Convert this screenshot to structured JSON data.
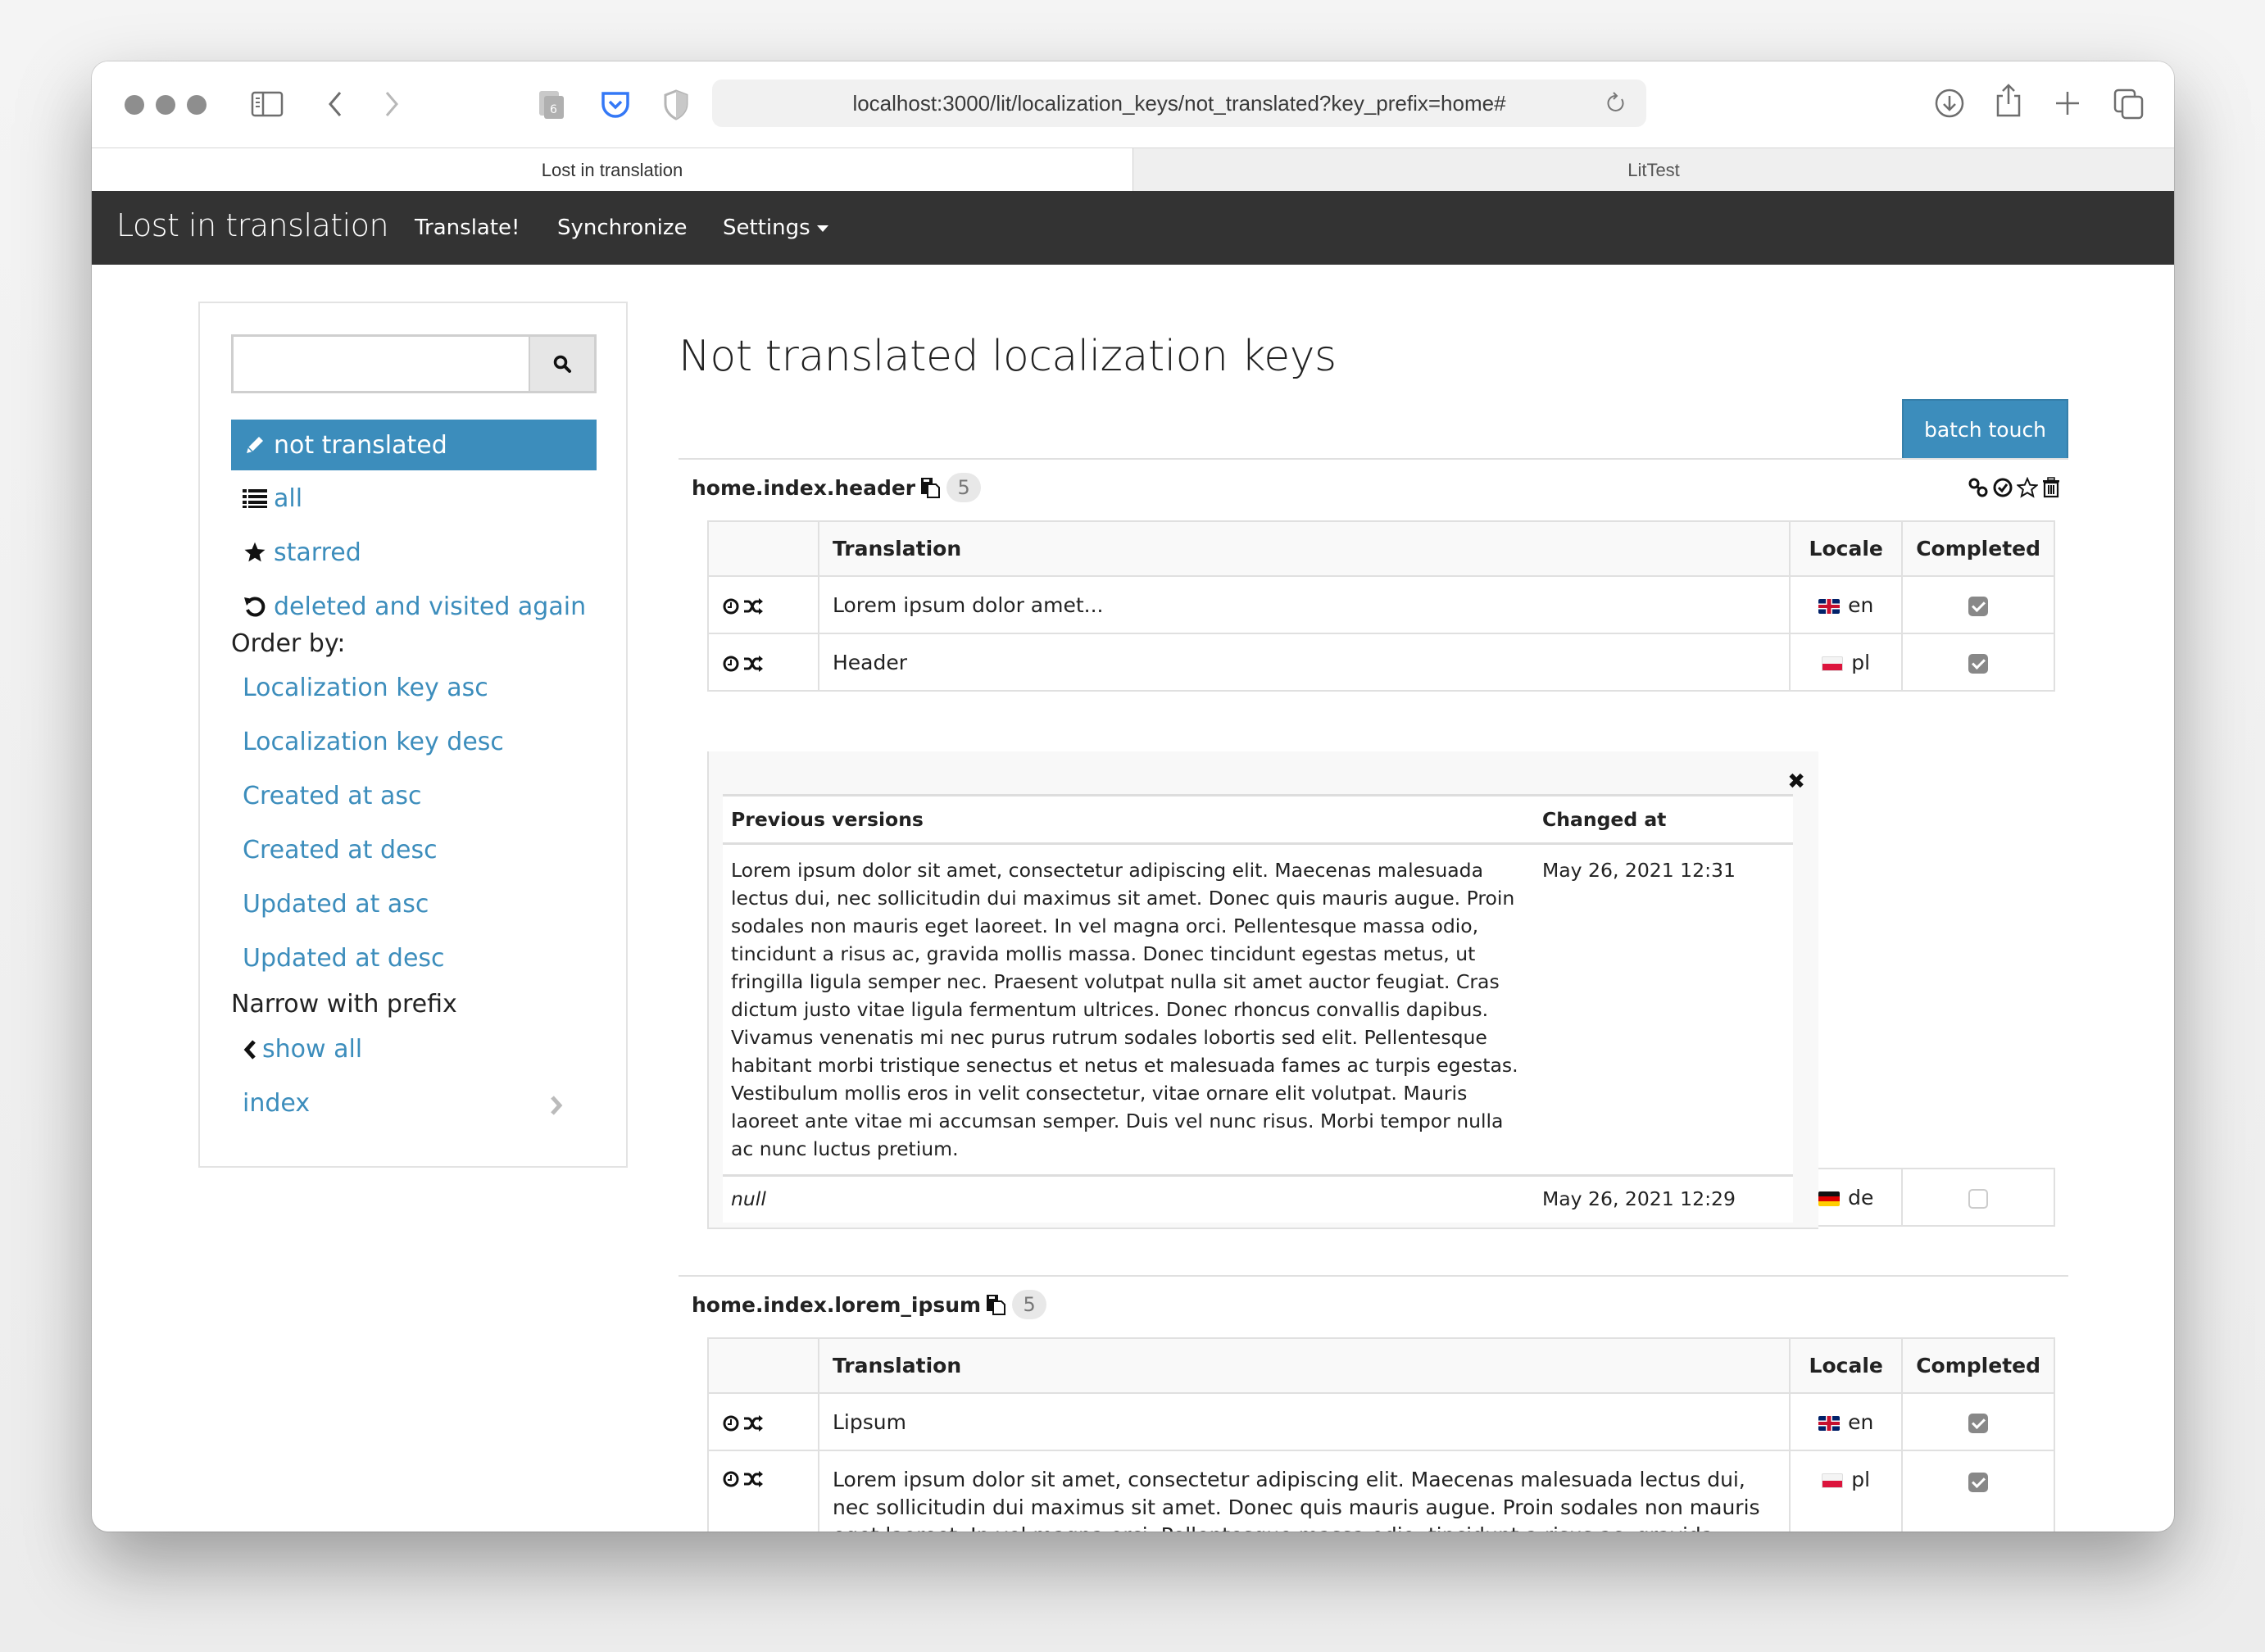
{
  "browser": {
    "url": "localhost:3000/lit/localization_keys/not_translated?key_prefix=home#",
    "tabs": [
      {
        "label": "Lost in translation",
        "active": true
      },
      {
        "label": "LitTest",
        "active": false
      }
    ]
  },
  "navbar": {
    "brand": "Lost in translation",
    "links": [
      "Translate!",
      "Synchronize",
      "Settings"
    ]
  },
  "sidebar": {
    "search": {
      "value": "",
      "placeholder": ""
    },
    "filters": [
      {
        "label": "not translated",
        "icon": "pencil-icon",
        "active": true
      },
      {
        "label": "all",
        "icon": "list-icon",
        "active": false
      },
      {
        "label": "starred",
        "icon": "star-icon",
        "active": false
      },
      {
        "label": "deleted and visited again",
        "icon": "undo-icon",
        "active": false
      }
    ],
    "order_label": "Order by:",
    "order_options": [
      "Localization key asc",
      "Localization key desc",
      "Created at asc",
      "Created at desc",
      "Updated at asc",
      "Updated at desc"
    ],
    "prefix_label": "Narrow with prefix",
    "show_all": "show all",
    "prefixes": [
      "index"
    ]
  },
  "main": {
    "title": "Not translated localization keys",
    "batch_touch": "batch touch",
    "columns": {
      "translation": "Translation",
      "locale": "Locale",
      "completed": "Completed"
    },
    "keys": [
      {
        "name": "home.index.header",
        "count": "5",
        "rows": [
          {
            "translation": "Lorem ipsum dolor amet...",
            "locale": "en",
            "completed": true,
            "has_versions": true
          },
          {
            "translation": "Header",
            "locale": "pl",
            "completed": true,
            "has_versions": true
          },
          {
            "translation": "null",
            "locale": "de",
            "completed": false,
            "has_versions": false
          }
        ],
        "versions": {
          "col_prev": "Previous versions",
          "col_changed": "Changed at",
          "entries": [
            {
              "text": "Lorem ipsum dolor sit amet, consectetur adipiscing elit. Maecenas malesuada lectus dui, nec sollicitudin dui maximus sit amet. Donec quis mauris augue. Proin sodales non mauris eget laoreet. In vel magna orci. Pellentesque massa odio, tincidunt a risus ac, gravida mollis massa. Donec tincidunt egestas metus, ut fringilla ligula semper nec. Praesent volutpat nulla sit amet auctor feugiat. Cras dictum justo vitae ligula fermentum ultrices. Donec rhoncus convallis dapibus. Vivamus venenatis mi nec purus rutrum sodales lobortis sed elit. Pellentesque habitant morbi tristique senectus et netus et malesuada fames ac turpis egestas. Vestibulum mollis eros in velit consectetur, vitae ornare elit volutpat. Mauris laoreet ante vitae mi accumsan semper. Duis vel nunc risus. Morbi tempor nulla ac nunc luctus pretium.",
              "changed_at": "May 26, 2021 12:31"
            },
            {
              "text": "null",
              "changed_at": "May 26, 2021 12:29"
            }
          ]
        }
      },
      {
        "name": "home.index.lorem_ipsum",
        "count": "5",
        "rows": [
          {
            "translation": "Lipsum",
            "locale": "en",
            "completed": true
          },
          {
            "translation": "Lorem ipsum dolor sit amet, consectetur adipiscing elit. Maecenas malesuada lectus dui, nec sollicitudin dui maximus sit amet. Donec quis mauris augue. Proin sodales non mauris eget laoreet. In vel magna orci. Pellentesque massa odio, tincidunt a risus ac, gravida mollis massa. Donec tincidunt egestas metus",
            "locale": "pl",
            "completed": true
          }
        ]
      }
    ]
  },
  "colors": {
    "accent": "#3c8dbc",
    "navbar": "#333333"
  }
}
